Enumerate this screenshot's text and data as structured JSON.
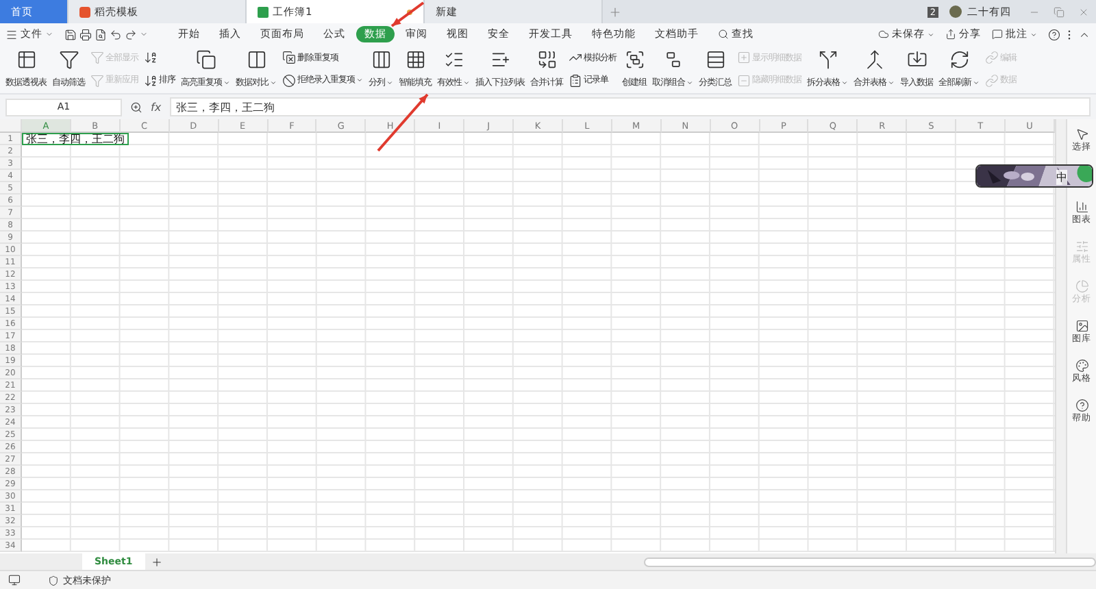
{
  "title_tabs": [
    {
      "label": "首页",
      "kind": "home",
      "selected": false
    },
    {
      "label": "稻壳模板",
      "kind": "doc",
      "selected": false
    },
    {
      "label": "工作簿1",
      "kind": "sheet",
      "selected": true
    },
    {
      "label": "新建",
      "kind": "plain",
      "selected": false
    }
  ],
  "account": {
    "badge": "2",
    "user": "二十有四"
  },
  "file_menu": "文件",
  "ribbon_tabs": [
    {
      "label": "开始",
      "selected": false
    },
    {
      "label": "插入",
      "selected": false
    },
    {
      "label": "页面布局",
      "selected": false
    },
    {
      "label": "公式",
      "selected": false
    },
    {
      "label": "数据",
      "selected": true
    },
    {
      "label": "审阅",
      "selected": false
    },
    {
      "label": "视图",
      "selected": false
    },
    {
      "label": "安全",
      "selected": false
    },
    {
      "label": "开发工具",
      "selected": false
    },
    {
      "label": "特色功能",
      "selected": false
    },
    {
      "label": "文档助手",
      "selected": false
    }
  ],
  "search": "查找",
  "right_actions": [
    {
      "label": "未保存",
      "dropdown": true
    },
    {
      "label": "分享",
      "dropdown": false
    },
    {
      "label": "批注",
      "dropdown": true
    }
  ],
  "ribbon": [
    {
      "kind": "big",
      "label": "数据透视表",
      "dropdown": false,
      "disabled": false
    },
    {
      "kind": "big",
      "label": "自动筛选",
      "dropdown": false,
      "disabled": false
    },
    {
      "kind": "stack",
      "items": [
        {
          "label": "全部显示",
          "dropdown": false,
          "disabled": true
        },
        {
          "label": "重新应用",
          "dropdown": false,
          "disabled": true
        }
      ]
    },
    {
      "kind": "stack",
      "items": [
        {
          "dropdown": false,
          "disabled": false
        },
        {
          "label": "排序",
          "dropdown": false,
          "disabled": false
        }
      ]
    },
    {
      "kind": "big",
      "label": "高亮重复项",
      "dropdown": true,
      "disabled": false
    },
    {
      "kind": "big",
      "label": "数据对比",
      "dropdown": true,
      "disabled": false
    },
    {
      "kind": "stack",
      "items": [
        {
          "label": "删除重复项",
          "dropdown": false,
          "disabled": false
        },
        {
          "label": "拒绝录入重复项",
          "dropdown": true,
          "disabled": false
        }
      ]
    },
    {
      "kind": "big",
      "label": "分列",
      "dropdown": true,
      "disabled": false
    },
    {
      "kind": "big",
      "label": "智能填充",
      "dropdown": false,
      "disabled": false
    },
    {
      "kind": "big",
      "label": "有效性",
      "dropdown": true,
      "disabled": false
    },
    {
      "kind": "big",
      "label": "插入下拉列表",
      "dropdown": false,
      "disabled": false
    },
    {
      "kind": "big",
      "label": "合并计算",
      "dropdown": false,
      "disabled": false
    },
    {
      "kind": "stack",
      "items": [
        {
          "label": "模拟分析",
          "dropdown": false,
          "disabled": false
        },
        {
          "label": "记录单",
          "dropdown": false,
          "disabled": false
        }
      ]
    },
    {
      "kind": "big",
      "label": "创建组",
      "dropdown": false,
      "disabled": false
    },
    {
      "kind": "big",
      "label": "取消组合",
      "dropdown": true,
      "disabled": false
    },
    {
      "kind": "big",
      "label": "分类汇总",
      "dropdown": false,
      "disabled": false
    },
    {
      "kind": "stack",
      "items": [
        {
          "label": "显示明细数据",
          "dropdown": false,
          "disabled": true
        },
        {
          "label": "隐藏明细数据",
          "dropdown": false,
          "disabled": true
        }
      ]
    },
    {
      "kind": "big",
      "label": "拆分表格",
      "dropdown": true,
      "disabled": false
    },
    {
      "kind": "big",
      "label": "合并表格",
      "dropdown": true,
      "disabled": false
    },
    {
      "kind": "big",
      "label": "导入数据",
      "dropdown": false,
      "disabled": false
    },
    {
      "kind": "big",
      "label": "全部刷新",
      "dropdown": true,
      "disabled": false
    },
    {
      "kind": "stack",
      "items": [
        {
          "label": "编辑",
          "dropdown": false,
          "disabled": true
        },
        {
          "label": "数据",
          "dropdown": false,
          "disabled": true
        }
      ]
    }
  ],
  "formula_bar": {
    "name_box": "A1",
    "fx": "fx",
    "value": "张三，李四，王二狗"
  },
  "grid": {
    "columns": [
      {
        "label": "A",
        "selected": true
      },
      {
        "label": "B",
        "selected": false
      },
      {
        "label": "C",
        "selected": false
      },
      {
        "label": "D",
        "selected": false
      },
      {
        "label": "E",
        "selected": false
      },
      {
        "label": "F",
        "selected": false
      },
      {
        "label": "G",
        "selected": false
      },
      {
        "label": "H",
        "selected": false
      },
      {
        "label": "I",
        "selected": false
      },
      {
        "label": "J",
        "selected": false
      },
      {
        "label": "K",
        "selected": false
      },
      {
        "label": "L",
        "selected": false
      },
      {
        "label": "M",
        "selected": false
      },
      {
        "label": "N",
        "selected": false
      },
      {
        "label": "O",
        "selected": false
      },
      {
        "label": "P",
        "selected": false
      },
      {
        "label": "Q",
        "selected": false
      },
      {
        "label": "R",
        "selected": false
      },
      {
        "label": "S",
        "selected": false
      },
      {
        "label": "T",
        "selected": false
      },
      {
        "label": "U",
        "selected": false
      }
    ],
    "rows": [
      {
        "number": "1",
        "cells": [
          {
            "text": "张三，李四，王二狗",
            "selected": true
          }
        ]
      },
      {
        "number": "2"
      },
      {
        "number": "3"
      },
      {
        "number": "4"
      },
      {
        "number": "5"
      },
      {
        "number": "6"
      },
      {
        "number": "7"
      },
      {
        "number": "8"
      },
      {
        "number": "9"
      },
      {
        "number": "10"
      },
      {
        "number": "11"
      },
      {
        "number": "12"
      },
      {
        "number": "13"
      },
      {
        "number": "14"
      },
      {
        "number": "15"
      },
      {
        "number": "16"
      },
      {
        "number": "17"
      },
      {
        "number": "18"
      },
      {
        "number": "19"
      },
      {
        "number": "20"
      },
      {
        "number": "21"
      },
      {
        "number": "22"
      },
      {
        "number": "23"
      },
      {
        "number": "24"
      },
      {
        "number": "25"
      },
      {
        "number": "26"
      },
      {
        "number": "27"
      },
      {
        "number": "28"
      },
      {
        "number": "29"
      },
      {
        "number": "30"
      },
      {
        "number": "31"
      },
      {
        "number": "32"
      },
      {
        "number": "33"
      },
      {
        "number": "34"
      }
    ]
  },
  "side_panel": [
    {
      "label": "选择",
      "disabled": false
    },
    {
      "label": "图表",
      "disabled": false
    },
    {
      "label": "属性",
      "disabled": true
    },
    {
      "label": "分析",
      "disabled": true
    },
    {
      "label": "图库",
      "disabled": false
    },
    {
      "label": "风格",
      "disabled": false
    },
    {
      "label": "帮助",
      "disabled": false
    }
  ],
  "floating_widget": {
    "label": "中"
  },
  "sheets": [
    {
      "label": "Sheet1",
      "selected": true
    }
  ],
  "status": "文档未保护"
}
